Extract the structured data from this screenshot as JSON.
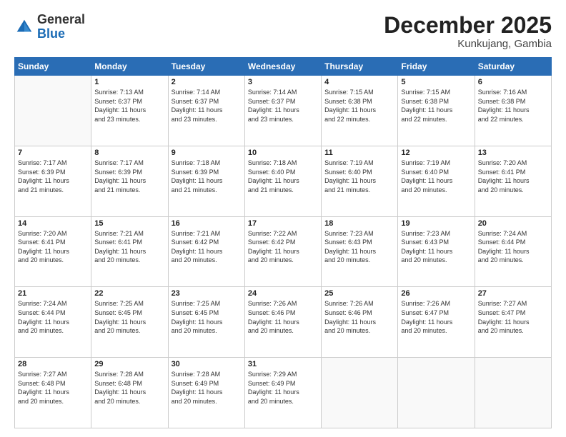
{
  "header": {
    "logo_general": "General",
    "logo_blue": "Blue",
    "month": "December 2025",
    "location": "Kunkujang, Gambia"
  },
  "days_of_week": [
    "Sunday",
    "Monday",
    "Tuesday",
    "Wednesday",
    "Thursday",
    "Friday",
    "Saturday"
  ],
  "weeks": [
    [
      {
        "day": "",
        "info": ""
      },
      {
        "day": "1",
        "info": "Sunrise: 7:13 AM\nSunset: 6:37 PM\nDaylight: 11 hours\nand 23 minutes."
      },
      {
        "day": "2",
        "info": "Sunrise: 7:14 AM\nSunset: 6:37 PM\nDaylight: 11 hours\nand 23 minutes."
      },
      {
        "day": "3",
        "info": "Sunrise: 7:14 AM\nSunset: 6:37 PM\nDaylight: 11 hours\nand 23 minutes."
      },
      {
        "day": "4",
        "info": "Sunrise: 7:15 AM\nSunset: 6:38 PM\nDaylight: 11 hours\nand 22 minutes."
      },
      {
        "day": "5",
        "info": "Sunrise: 7:15 AM\nSunset: 6:38 PM\nDaylight: 11 hours\nand 22 minutes."
      },
      {
        "day": "6",
        "info": "Sunrise: 7:16 AM\nSunset: 6:38 PM\nDaylight: 11 hours\nand 22 minutes."
      }
    ],
    [
      {
        "day": "7",
        "info": "Sunrise: 7:17 AM\nSunset: 6:39 PM\nDaylight: 11 hours\nand 21 minutes."
      },
      {
        "day": "8",
        "info": "Sunrise: 7:17 AM\nSunset: 6:39 PM\nDaylight: 11 hours\nand 21 minutes."
      },
      {
        "day": "9",
        "info": "Sunrise: 7:18 AM\nSunset: 6:39 PM\nDaylight: 11 hours\nand 21 minutes."
      },
      {
        "day": "10",
        "info": "Sunrise: 7:18 AM\nSunset: 6:40 PM\nDaylight: 11 hours\nand 21 minutes."
      },
      {
        "day": "11",
        "info": "Sunrise: 7:19 AM\nSunset: 6:40 PM\nDaylight: 11 hours\nand 21 minutes."
      },
      {
        "day": "12",
        "info": "Sunrise: 7:19 AM\nSunset: 6:40 PM\nDaylight: 11 hours\nand 20 minutes."
      },
      {
        "day": "13",
        "info": "Sunrise: 7:20 AM\nSunset: 6:41 PM\nDaylight: 11 hours\nand 20 minutes."
      }
    ],
    [
      {
        "day": "14",
        "info": "Sunrise: 7:20 AM\nSunset: 6:41 PM\nDaylight: 11 hours\nand 20 minutes."
      },
      {
        "day": "15",
        "info": "Sunrise: 7:21 AM\nSunset: 6:41 PM\nDaylight: 11 hours\nand 20 minutes."
      },
      {
        "day": "16",
        "info": "Sunrise: 7:21 AM\nSunset: 6:42 PM\nDaylight: 11 hours\nand 20 minutes."
      },
      {
        "day": "17",
        "info": "Sunrise: 7:22 AM\nSunset: 6:42 PM\nDaylight: 11 hours\nand 20 minutes."
      },
      {
        "day": "18",
        "info": "Sunrise: 7:23 AM\nSunset: 6:43 PM\nDaylight: 11 hours\nand 20 minutes."
      },
      {
        "day": "19",
        "info": "Sunrise: 7:23 AM\nSunset: 6:43 PM\nDaylight: 11 hours\nand 20 minutes."
      },
      {
        "day": "20",
        "info": "Sunrise: 7:24 AM\nSunset: 6:44 PM\nDaylight: 11 hours\nand 20 minutes."
      }
    ],
    [
      {
        "day": "21",
        "info": "Sunrise: 7:24 AM\nSunset: 6:44 PM\nDaylight: 11 hours\nand 20 minutes."
      },
      {
        "day": "22",
        "info": "Sunrise: 7:25 AM\nSunset: 6:45 PM\nDaylight: 11 hours\nand 20 minutes."
      },
      {
        "day": "23",
        "info": "Sunrise: 7:25 AM\nSunset: 6:45 PM\nDaylight: 11 hours\nand 20 minutes."
      },
      {
        "day": "24",
        "info": "Sunrise: 7:26 AM\nSunset: 6:46 PM\nDaylight: 11 hours\nand 20 minutes."
      },
      {
        "day": "25",
        "info": "Sunrise: 7:26 AM\nSunset: 6:46 PM\nDaylight: 11 hours\nand 20 minutes."
      },
      {
        "day": "26",
        "info": "Sunrise: 7:26 AM\nSunset: 6:47 PM\nDaylight: 11 hours\nand 20 minutes."
      },
      {
        "day": "27",
        "info": "Sunrise: 7:27 AM\nSunset: 6:47 PM\nDaylight: 11 hours\nand 20 minutes."
      }
    ],
    [
      {
        "day": "28",
        "info": "Sunrise: 7:27 AM\nSunset: 6:48 PM\nDaylight: 11 hours\nand 20 minutes."
      },
      {
        "day": "29",
        "info": "Sunrise: 7:28 AM\nSunset: 6:48 PM\nDaylight: 11 hours\nand 20 minutes."
      },
      {
        "day": "30",
        "info": "Sunrise: 7:28 AM\nSunset: 6:49 PM\nDaylight: 11 hours\nand 20 minutes."
      },
      {
        "day": "31",
        "info": "Sunrise: 7:29 AM\nSunset: 6:49 PM\nDaylight: 11 hours\nand 20 minutes."
      },
      {
        "day": "",
        "info": ""
      },
      {
        "day": "",
        "info": ""
      },
      {
        "day": "",
        "info": ""
      }
    ]
  ]
}
